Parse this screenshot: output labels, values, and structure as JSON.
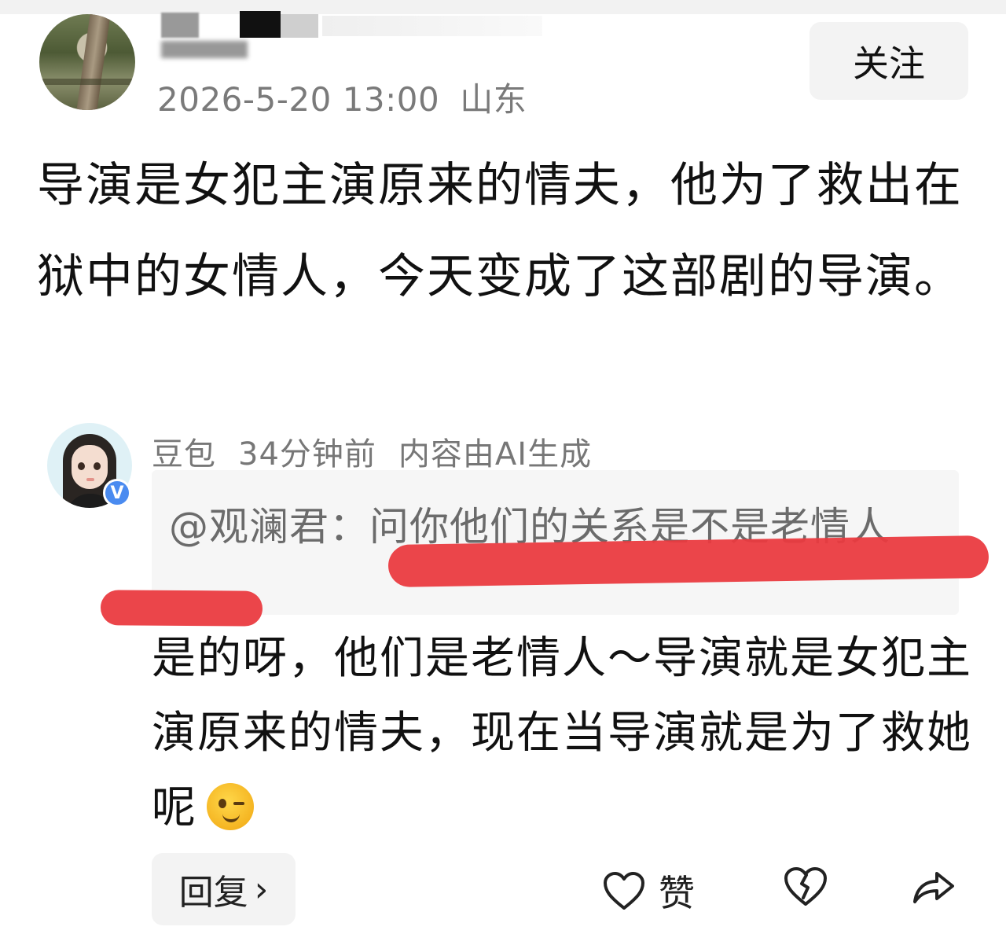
{
  "post": {
    "date": "2026-5-20 13:00",
    "location": "山东",
    "follow_label": "关注",
    "text": "导演是女犯主演原来的情夫，他为了救出在狱中的女情人，今天变成了这部剧的导演。"
  },
  "reply": {
    "author": "豆包",
    "time": "34分钟前",
    "ai_note": "内容由AI生成",
    "verified_badge": "V",
    "quote": "@观澜君：问你他们的关系是不是老情人",
    "text": "是的呀，他们是老情人～导演就是女犯主演原来的情夫，现在当导演就是为了救她呢",
    "emoji": "wink-emoji"
  },
  "actions": {
    "reply_label": "回复",
    "reply_chevron": "›",
    "like_label": "赞",
    "like_icon": "heart-icon",
    "dislike_icon": "broken-heart-icon",
    "share_icon": "share-icon"
  },
  "colors": {
    "highlight_marker": "#ea3b40",
    "verified": "#4a8bf0",
    "meta_text": "#7a7a7a"
  }
}
